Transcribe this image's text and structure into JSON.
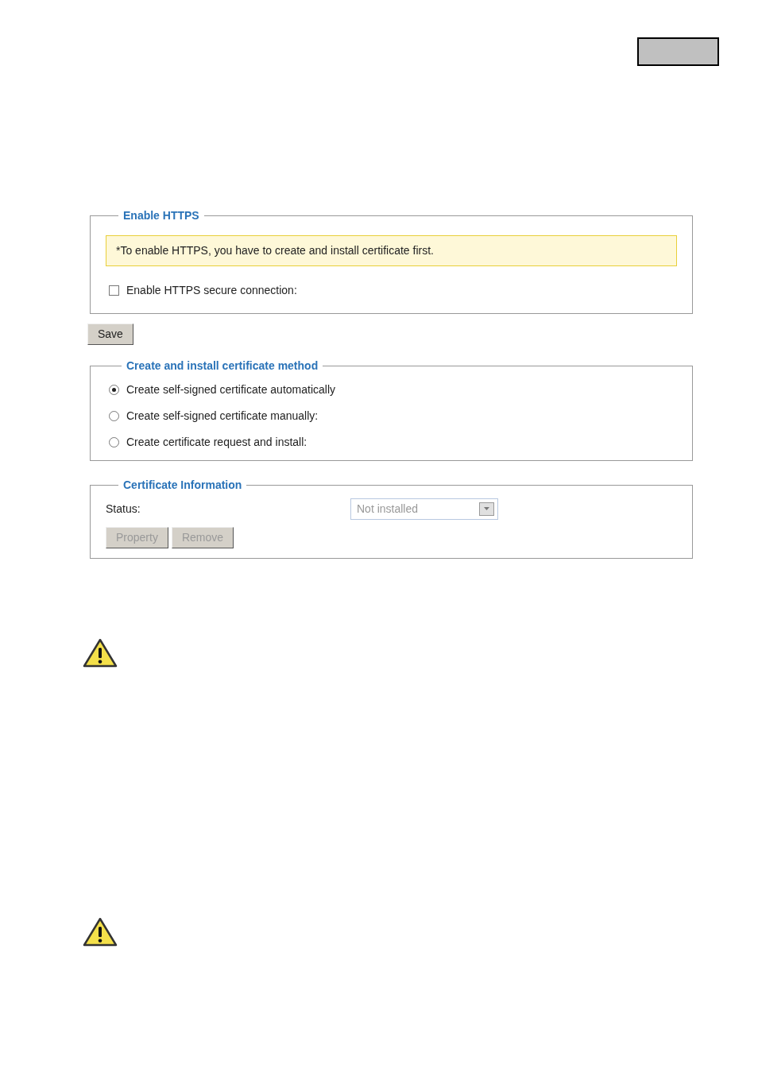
{
  "enable_https": {
    "legend": "Enable HTTPS",
    "notice": "*To enable HTTPS, you have to create and install certificate first.",
    "checkbox": {
      "label": "Enable HTTPS secure connection:",
      "checked": false
    }
  },
  "save_button": "Save",
  "method": {
    "legend": "Create and install certificate method",
    "options": [
      {
        "label": "Create self-signed certificate automatically",
        "selected": true
      },
      {
        "label": "Create self-signed certificate manually:",
        "selected": false
      },
      {
        "label": "Create certificate request and install:",
        "selected": false
      }
    ]
  },
  "certificate_info": {
    "legend": "Certificate Information",
    "status_label": "Status:",
    "status": {
      "value": "Not installed",
      "disabled": true
    },
    "buttons": [
      {
        "label": "Property",
        "disabled": true
      },
      {
        "label": "Remove",
        "disabled": true
      }
    ]
  },
  "warnings": [
    {
      "kind": "warning"
    },
    {
      "kind": "warning"
    }
  ]
}
